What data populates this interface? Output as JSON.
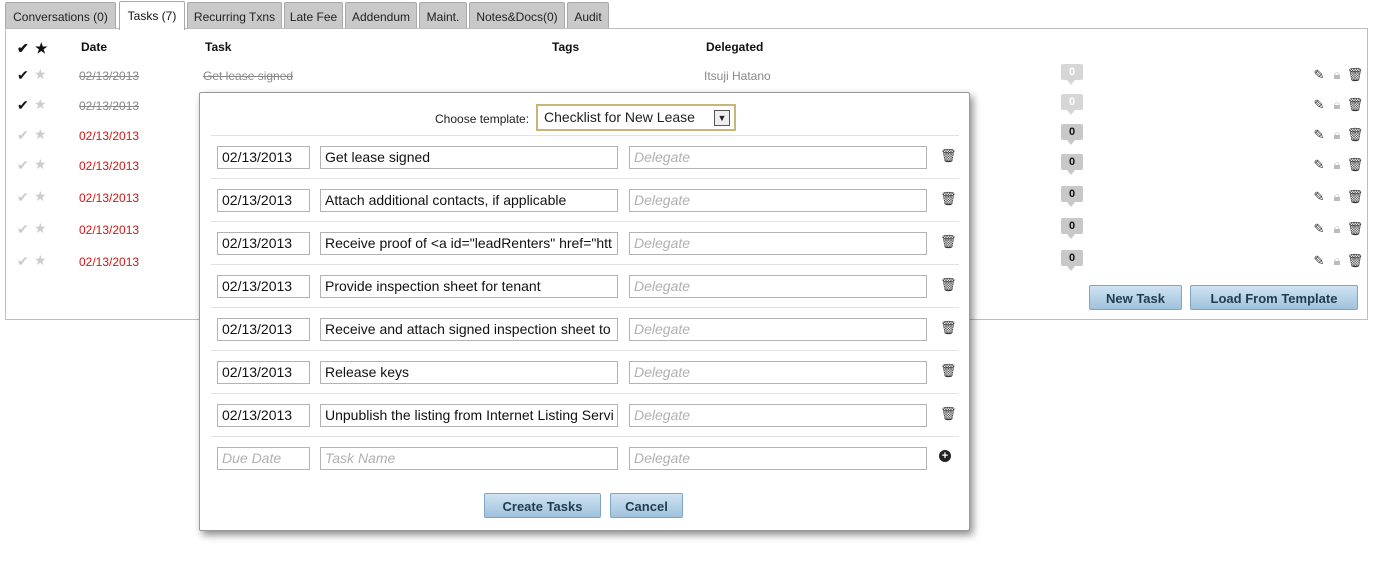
{
  "tabs": [
    {
      "label": "Conversations (0)",
      "active": false
    },
    {
      "label": "Tasks (7)",
      "active": true
    },
    {
      "label": "Recurring Txns",
      "active": false
    },
    {
      "label": "Late Fee",
      "active": false
    },
    {
      "label": "Addendum",
      "active": false
    },
    {
      "label": "Maint.",
      "active": false
    },
    {
      "label": "Notes&Docs(0)",
      "active": false
    },
    {
      "label": "Audit",
      "active": false
    }
  ],
  "table": {
    "headers": {
      "check": "✔",
      "star": "★",
      "date": "Date",
      "task": "Task",
      "tags": "Tags",
      "delegated": "Delegated"
    },
    "rows": [
      {
        "date": "02/13/2013",
        "task": "Get lease signed",
        "delegated": "Itsuji Hatano",
        "comments": "0",
        "state": "done"
      },
      {
        "date": "02/13/2013",
        "task": "",
        "delegated": "",
        "comments": "0",
        "state": "done"
      },
      {
        "date": "02/13/2013",
        "task": "",
        "delegated": "",
        "comments": "0",
        "state": "overdue"
      },
      {
        "date": "02/13/2013",
        "task": "",
        "delegated": "",
        "comments": "0",
        "state": "overdue"
      },
      {
        "date": "02/13/2013",
        "task": "",
        "delegated": "",
        "comments": "0",
        "state": "overdue"
      },
      {
        "date": "02/13/2013",
        "task": "",
        "delegated": "",
        "comments": "0",
        "state": "overdue"
      },
      {
        "date": "02/13/2013",
        "task": "",
        "delegated": "",
        "comments": "0",
        "state": "overdue"
      }
    ]
  },
  "buttons": {
    "new_task": "New Task",
    "load_template": "Load From Template"
  },
  "modal": {
    "choose_label": "Choose template:",
    "template_selected": "Checklist for New Lease",
    "rows": [
      {
        "date": "02/13/2013",
        "name": "Get lease signed",
        "delegate_placeholder": "Delegate"
      },
      {
        "date": "02/13/2013",
        "name": "Attach additional contacts, if applicable",
        "delegate_placeholder": "Delegate"
      },
      {
        "date": "02/13/2013",
        "name": "Receive proof of <a id=\"leadRenters\" href=\"htt",
        "delegate_placeholder": "Delegate"
      },
      {
        "date": "02/13/2013",
        "name": "Provide inspection sheet for tenant",
        "delegate_placeholder": "Delegate"
      },
      {
        "date": "02/13/2013",
        "name": "Receive and attach signed inspection sheet  to",
        "delegate_placeholder": "Delegate"
      },
      {
        "date": "02/13/2013",
        "name": "Release keys",
        "delegate_placeholder": "Delegate"
      },
      {
        "date": "02/13/2013",
        "name": "Unpublish the listing from Internet Listing Servi",
        "delegate_placeholder": "Delegate"
      }
    ],
    "new_row": {
      "date_placeholder": "Due Date",
      "name_placeholder": "Task Name",
      "delegate_placeholder": "Delegate"
    },
    "create_button": "Create Tasks",
    "cancel_button": "Cancel"
  }
}
